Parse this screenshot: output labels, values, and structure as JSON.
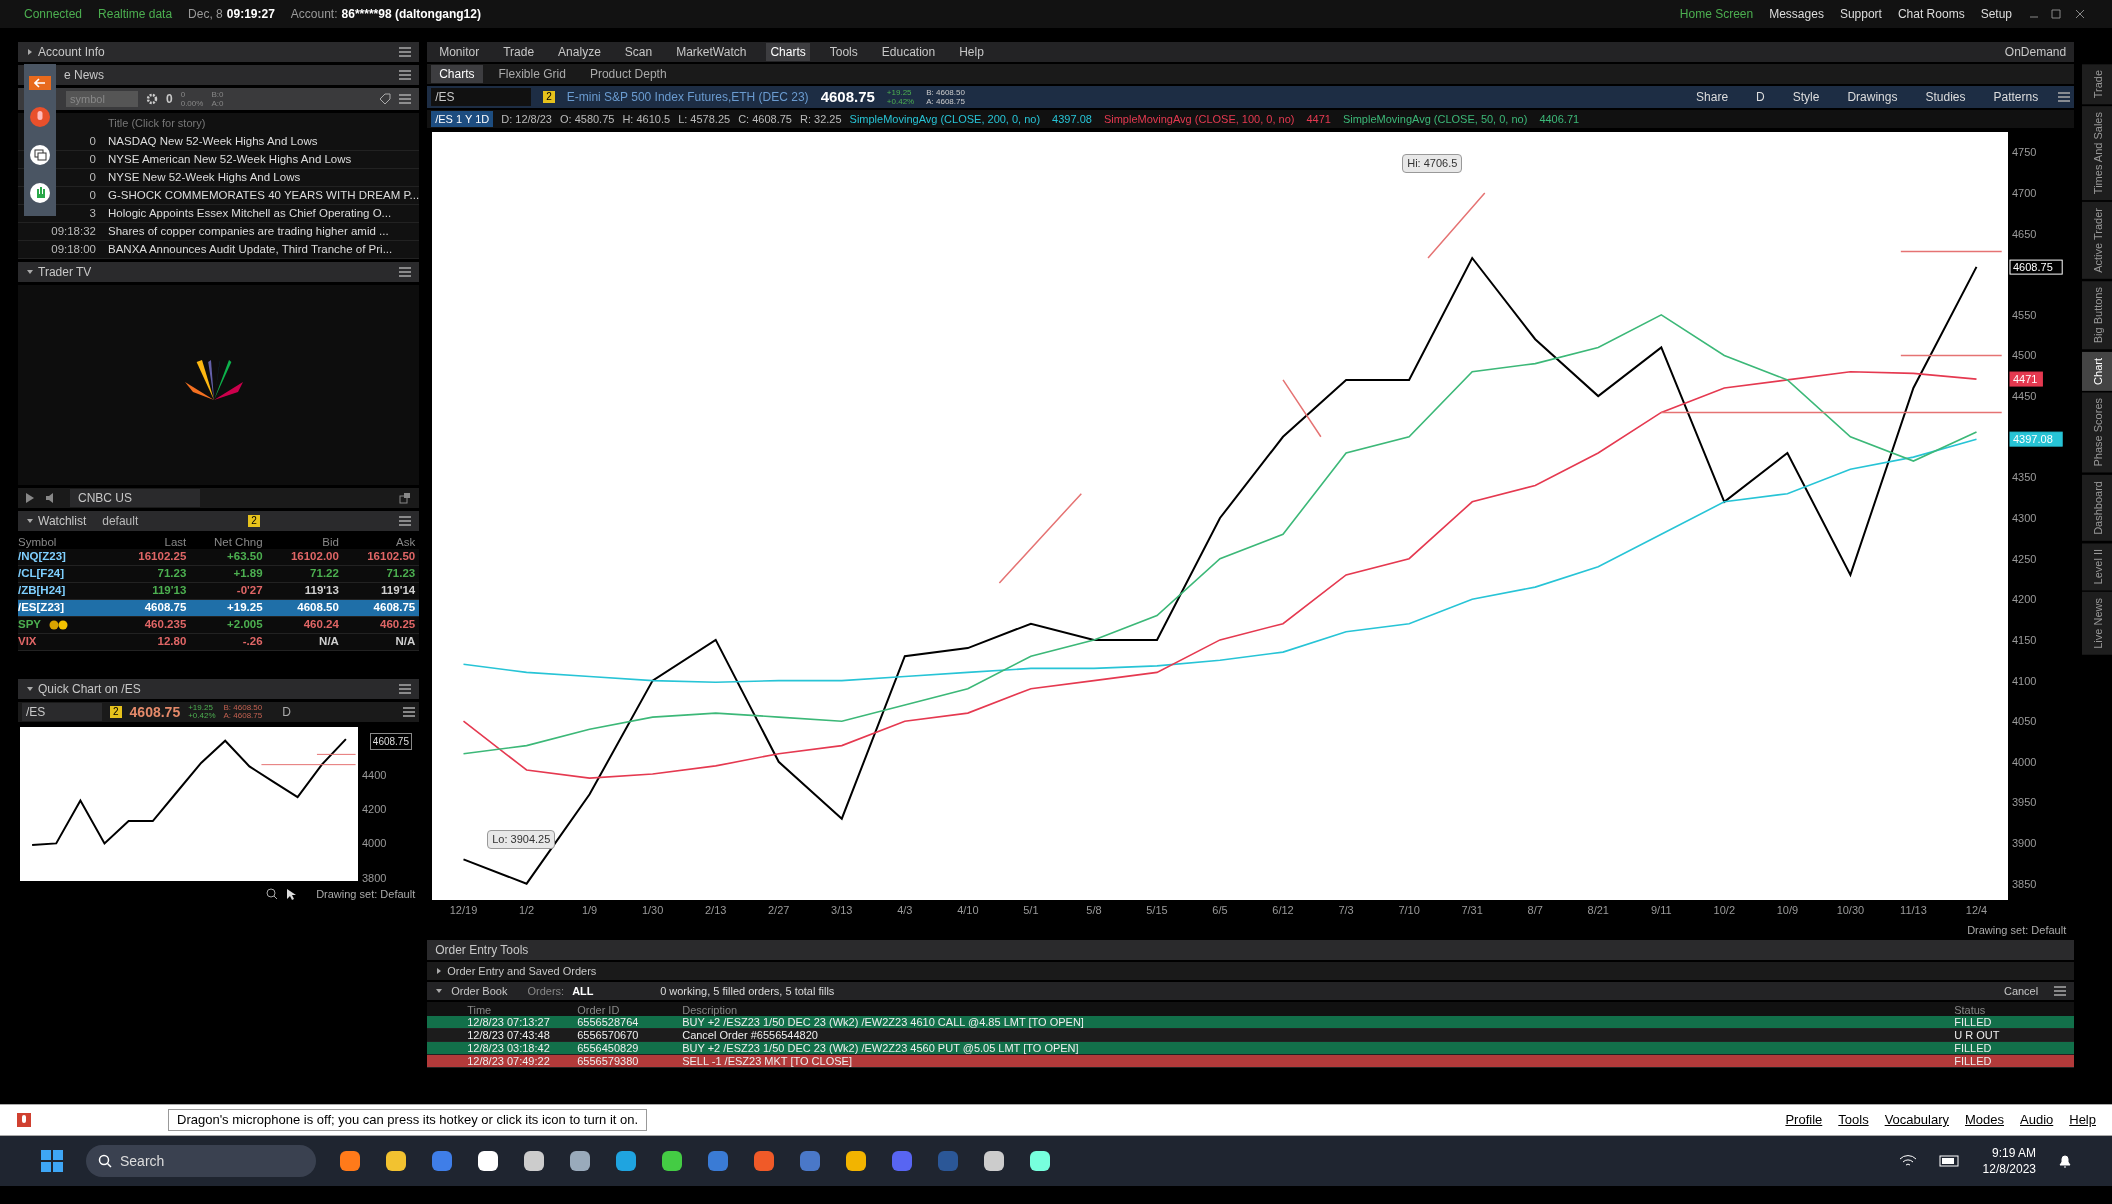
{
  "status_bar": {
    "connection": "Connected",
    "feed": "Realtime data",
    "date": "Dec, 8",
    "time": "09:19:27",
    "account_label": "Account:",
    "account": "86*****98 (daltongang12)",
    "links": [
      "Home Screen",
      "Messages",
      "Support",
      "Chat Rooms",
      "Setup"
    ]
  },
  "left": {
    "account_info": "Account Info",
    "news": {
      "title": "e News",
      "symbol_placeholder": "symbol",
      "count": "0",
      "change": "0",
      "percent": "0.00%",
      "bid": "B:0",
      "ask": "A:0",
      "column": "Title (Click for story)",
      "rows": [
        {
          "time": "0",
          "title": "NASDAQ New 52-Week Highs And Lows"
        },
        {
          "time": "0",
          "title": "NYSE American New 52-Week Highs And Lows"
        },
        {
          "time": "0",
          "title": "NYSE New 52-Week Highs And Lows"
        },
        {
          "time": "0",
          "title": "G-SHOCK COMMEMORATES 40 YEARS WITH DREAM P..."
        },
        {
          "time": "3",
          "title": "Hologic Appoints Essex Mitchell as Chief Operating O..."
        },
        {
          "time": "09:18:32",
          "title": "Shares of copper companies are trading higher amid ..."
        },
        {
          "time": "09:18:00",
          "title": "BANXA Announces Audit Update, Third Tranche of Pri..."
        }
      ]
    },
    "trader_tv": {
      "title": "Trader TV",
      "channel": "CNBC US"
    },
    "watchlist": {
      "title": "Watchlist",
      "list": "default",
      "link": "2",
      "columns": [
        "Symbol",
        "Last",
        "Net Chng",
        "Bid",
        "Ask"
      ],
      "rows": [
        {
          "selected": false,
          "badge": false,
          "cells": [
            {
              "text": "/NQ[Z23]",
              "color": "#7fd0ff"
            },
            {
              "text": "16102.25",
              "color": "#e06666"
            },
            {
              "text": "+63.50",
              "color": "#4caf50"
            },
            {
              "text": "16102.00",
              "color": "#e06666"
            },
            {
              "text": "16102.50",
              "color": "#e06666"
            }
          ]
        },
        {
          "selected": false,
          "badge": false,
          "cells": [
            {
              "text": "/CL[F24]",
              "color": "#7fd0ff"
            },
            {
              "text": "71.23",
              "color": "#4caf50"
            },
            {
              "text": "+1.89",
              "color": "#4caf50"
            },
            {
              "text": "71.22",
              "color": "#4caf50"
            },
            {
              "text": "71.23",
              "color": "#4caf50"
            }
          ]
        },
        {
          "selected": false,
          "badge": false,
          "cells": [
            {
              "text": "/ZB[H24]",
              "color": "#7fd0ff"
            },
            {
              "text": "119'13",
              "color": "#4caf50"
            },
            {
              "text": "-0'27",
              "color": "#e06666"
            },
            {
              "text": "119'13",
              "color": "#d0d0d0"
            },
            {
              "text": "119'14",
              "color": "#d0d0d0"
            }
          ]
        },
        {
          "selected": true,
          "badge": false,
          "cells": [
            {
              "text": "/ES[Z23]"
            },
            {
              "text": "4608.75"
            },
            {
              "text": "+19.25"
            },
            {
              "text": "4608.50"
            },
            {
              "text": "4608.75"
            }
          ]
        },
        {
          "selected": false,
          "badge": true,
          "cells": [
            {
              "text": "SPY",
              "color": "#4caf50"
            },
            {
              "text": "460.235",
              "color": "#e06666"
            },
            {
              "text": "+2.005",
              "color": "#4caf50"
            },
            {
              "text": "460.24",
              "color": "#e06666"
            },
            {
              "text": "460.25",
              "color": "#e06666"
            }
          ]
        },
        {
          "selected": false,
          "badge": false,
          "cells": [
            {
              "text": "VIX",
              "color": "#e06666"
            },
            {
              "text": "12.80",
              "color": "#e06666"
            },
            {
              "text": "-.26",
              "color": "#e06666"
            },
            {
              "text": "N/A",
              "color": "#d0d0d0"
            },
            {
              "text": "N/A",
              "color": "#d0d0d0"
            }
          ]
        }
      ]
    },
    "quick_chart": {
      "title": "Quick Chart on /ES",
      "symbol": "/ES",
      "link": "2",
      "price": "4608.75",
      "change": "+19.25",
      "percent": "+0.42%",
      "bid": "B: 4608.50",
      "ask": "A: 4608.75",
      "aggregation": "D",
      "last_label": "4608.75",
      "drawing_set": "Drawing set: Default",
      "chart_data": {
        "type": "line",
        "categories": [
          null,
          null,
          null,
          null,
          null,
          null,
          null,
          null,
          null,
          null,
          null,
          null,
          null,
          null
        ],
        "ylim": [
          3780,
          4680
        ],
        "yticks": [
          3800,
          4000,
          4200,
          4400
        ],
        "series": [
          {
            "color": "#000000",
            "values": [
              3990,
              4000,
              4250,
              4000,
              4130,
              4130,
              4300,
              4470,
              4600,
              4450,
              4360,
              4270,
              4460,
              4609
            ]
          }
        ]
      }
    }
  },
  "main": {
    "menu": [
      {
        "label": "Monitor",
        "selected": false
      },
      {
        "label": "Trade",
        "selected": false
      },
      {
        "label": "Analyze",
        "selected": false
      },
      {
        "label": "Scan",
        "selected": false
      },
      {
        "label": "MarketWatch",
        "selected": false
      },
      {
        "label": "Charts",
        "selected": true
      },
      {
        "label": "Tools",
        "selected": false
      },
      {
        "label": "Education",
        "selected": false
      },
      {
        "label": "Help",
        "selected": false
      }
    ],
    "on_demand": "OnDemand",
    "tabs": [
      {
        "label": "Charts",
        "selected": true
      },
      {
        "label": "Flexible Grid",
        "selected": false
      },
      {
        "label": "Product Depth",
        "selected": false
      }
    ],
    "symbol_bar": {
      "symbol": "/ES",
      "link": "2",
      "description": "E-mini S&P 500 Index Futures,ETH (DEC 23)",
      "price": "4608.75",
      "change": "+19.25",
      "percent": "+0.42%",
      "bid": "B: 4608.50",
      "ask": "A: 4608.75",
      "tools": [
        "Share",
        "D",
        "Style",
        "Drawings",
        "Studies",
        "Patterns"
      ]
    },
    "study_line": {
      "period": "/ES 1 Y 1D",
      "ohlc": [
        "D: 12/8/23",
        "O: 4580.75",
        "H: 4610.5",
        "L: 4578.25",
        "C: 4608.75",
        "R: 32.25"
      ],
      "study_values": [
        "4397.08",
        "4471",
        "4406.71"
      ]
    },
    "chart": {
      "high_label": "Hi: 4706.5",
      "low_label": "Lo: 3904.25",
      "price_markers": [
        {
          "text": "4608.75",
          "color": "#ffffff"
        },
        {
          "text": "4471",
          "color": "#e53950"
        },
        {
          "text": "4397.08",
          "color": "#27c4d6"
        }
      ],
      "drawing_set": "Drawing set: Default",
      "chart_data": {
        "type": "line",
        "categories": [
          "12/19",
          "1/2",
          "1/9",
          "1/30",
          "2/13",
          "2/27",
          "3/13",
          "4/3",
          "4/10",
          "5/1",
          "5/8",
          "5/15",
          "6/5",
          "6/12",
          "7/3",
          "7/10",
          "7/31",
          "8/7",
          "8/21",
          "9/11",
          "10/2",
          "10/9",
          "10/30",
          "11/13",
          "12/4"
        ],
        "ylim": [
          3830,
          4775
        ],
        "yticks": [
          3850,
          3900,
          3950,
          4000,
          4050,
          4100,
          4150,
          4200,
          4250,
          4300,
          4350,
          4450,
          4500,
          4550,
          4650,
          4700,
          4750
        ],
        "series": [
          {
            "color": "#000000",
            "values": [
              3880,
              3850,
              3960,
              4100,
              4150,
              4000,
              3930,
              4130,
              4140,
              4170,
              4150,
              4150,
              4300,
              4400,
              4470,
              4470,
              4620,
              4520,
              4450,
              4510,
              4320,
              4380,
              4230,
              4460,
              4609
            ]
          },
          {
            "name": "SimpleMovingAvg (CLOSE, 200, 0, no)",
            "color": "#27c4d6",
            "values": [
              4120,
              4110,
              4105,
              4100,
              4098,
              4100,
              4100,
              4105,
              4110,
              4115,
              4115,
              4118,
              4125,
              4135,
              4160,
              4170,
              4200,
              4215,
              4240,
              4280,
              4320,
              4330,
              4360,
              4375,
              4397
            ]
          },
          {
            "name": "SimpleMovingAvg (CLOSE, 100, 0, no)",
            "color": "#e53950",
            "values": [
              4050,
              3990,
              3980,
              3985,
              3995,
              4010,
              4020,
              4050,
              4060,
              4090,
              4100,
              4110,
              4150,
              4170,
              4230,
              4250,
              4320,
              4340,
              4380,
              4430,
              4460,
              4470,
              4480,
              4478,
              4471
            ]
          },
          {
            "name": "SimpleMovingAvg (CLOSE, 50, 0, no)",
            "color": "#3cb878",
            "values": [
              4010,
              4020,
              4040,
              4055,
              4060,
              4055,
              4050,
              4070,
              4090,
              4130,
              4150,
              4180,
              4250,
              4280,
              4380,
              4400,
              4480,
              4490,
              4510,
              4550,
              4500,
              4470,
              4400,
              4370,
              4406
            ]
          }
        ]
      }
    },
    "side_tabs": [
      {
        "label": "Trade",
        "selected": false
      },
      {
        "label": "Times And Sales",
        "selected": false
      },
      {
        "label": "Active Trader",
        "selected": false
      },
      {
        "label": "Big Buttons",
        "selected": false
      },
      {
        "label": "Chart",
        "selected": true
      },
      {
        "label": "Phase Scores",
        "selected": false
      },
      {
        "label": "Dashboard",
        "selected": false
      },
      {
        "label": "Level II",
        "selected": false
      },
      {
        "label": "Live News",
        "selected": false
      }
    ],
    "order_panel": {
      "title": "Order Entry Tools",
      "saved": "Order Entry and Saved Orders",
      "book": "Order Book",
      "orders_label": "Orders:",
      "orders_filter": "ALL",
      "summary": "0 working, 5 filled orders, 5 total fills",
      "cancel": "Cancel",
      "columns": [
        "Time",
        "Order ID",
        "Description",
        "Status"
      ],
      "rows": [
        {
          "time": "12/8/23 07:13:27",
          "id": "6556528764",
          "description": "BUY +2 /ESZ23 1/50 DEC 23 (Wk2) /EW2Z23 4610 CALL @4.85 LMT [TO OPEN]",
          "status": "FILLED",
          "color": "#12704a"
        },
        {
          "time": "12/8/23 07:43:48",
          "id": "6556570670",
          "description": "Cancel Order #6556544820",
          "status": "U R OUT",
          "color": "#1c1c1c"
        },
        {
          "time": "12/8/23 03:18:42",
          "id": "6556450829",
          "description": "BUY +2 /ESZ23 1/50 DEC 23 (Wk2) /EW2Z23 4560 PUT @5.05 LMT [TO OPEN]",
          "status": "FILLED",
          "color": "#12704a"
        },
        {
          "time": "12/8/23 07:49:22",
          "id": "6556579380",
          "description": "SELL -1 /ESZ23 MKT [TO CLOSE]",
          "status": "FILLED",
          "color": "#b23a3a"
        }
      ]
    }
  },
  "dragon_bar": {
    "message": "Dragon's microphone is off; you can press its hotkey or click its icon to turn it on.",
    "menu": [
      "Profile",
      "Tools",
      "Vocabulary",
      "Modes",
      "Audio",
      "Help"
    ]
  },
  "taskbar": {
    "search": "Search",
    "time": "9:19 AM",
    "date": "12/8/2023"
  }
}
